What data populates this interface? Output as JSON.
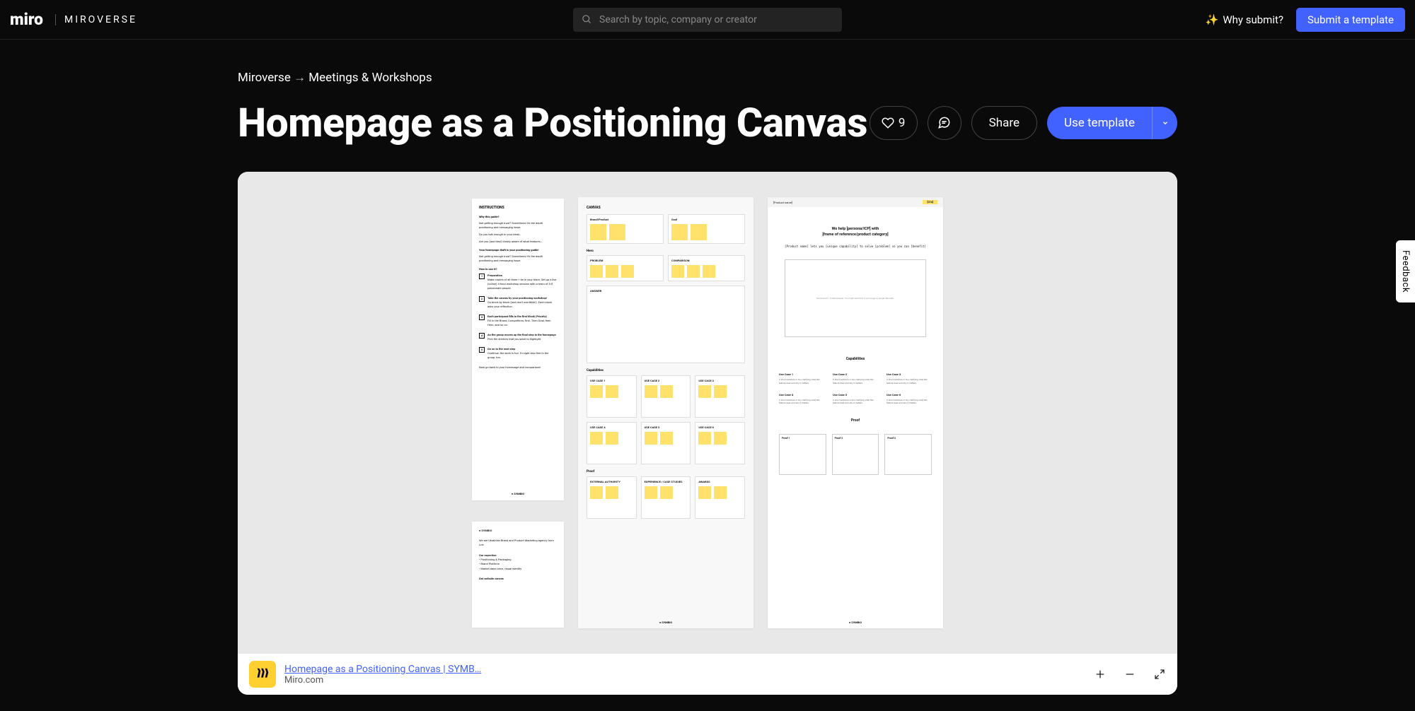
{
  "brand": {
    "name": "miro",
    "sub": "MIROVERSE"
  },
  "search": {
    "placeholder": "Search by topic, company or creator"
  },
  "header": {
    "why_submit": "Why submit?",
    "why_submit_emoji": "✨",
    "submit": "Submit a template"
  },
  "breadcrumb": {
    "root": "Miroverse",
    "arrow": "→",
    "category": "Meetings & Workshops"
  },
  "page": {
    "title": "Homepage as a Positioning Canvas"
  },
  "actions": {
    "likes": "9",
    "share": "Share",
    "use": "Use template"
  },
  "bottombar": {
    "title": "Homepage as a Positioning Canvas | SYMB…",
    "sub": "Miro.com"
  },
  "feedback": "Feedback",
  "preview": {
    "instructions": {
      "title": "INSTRUCTIONS",
      "why_h": "Why this guide?",
      "why_p1": "Not getting enough trust? Sometimes it's the depth positioning and messaging issue.",
      "why_p2": "Do you talk enough to your ideal…",
      "why_p3": "Are you (and they) clearly aware of what features…",
      "pos_h": "Your homepage draft is your positioning guide!",
      "how_h": "How to use it?",
      "steps": [
        {
          "n": "1",
          "h": "Preparation",
          "p": "Make copies of all three + be in your team. Set up a live (online) 4-hour workshop session with a team of 3-5 passionate people."
        },
        {
          "n": "2",
          "h": "Take the canvas by your positioning workshop!",
          "p": "Go block by block (and don't overthink!). Each block asks your reflection."
        },
        {
          "n": "3",
          "h": "Each participant fills in the first block (Priority)",
          "p": "Fill in the Brand, Competitors, first. Then Goal, then Hero, and so on."
        },
        {
          "n": "4",
          "h": "As the group moves up the final step in the homepage",
          "p": "Pick the stickers that you want to highlight."
        },
        {
          "n": "5",
          "h": "Go on to the next step",
          "p": "Continue, the work is fun. It might also feel in the group, too."
        }
      ],
      "footer": "Now go back to your homepage and comparison!",
      "brand_tag": "● SYMBIO"
    },
    "symbio": {
      "brand": "● SYMBIO",
      "p1": "We are Ukrainian Brand and Product Marketing agency from Lviv.",
      "skills_h": "Our expertise:",
      "skill1": "• Positioning & Packaging",
      "skill2": "• Brand Platform",
      "skill3": "• Market data voice, visual identity",
      "contact": "Get website canvas"
    },
    "canvas": {
      "title": "CANVAS",
      "brand_h": "Brand/Product",
      "goal_h": "Goal",
      "hero_h": "Hero",
      "problem_h": "PROBLEM",
      "comp_h": "COMPARISON",
      "answer_h": "ANSWER",
      "caps_h": "Capabilities",
      "uc1": "USE CASE 1",
      "uc2": "USE CASE 2",
      "uc3": "USE CASE 3",
      "uc4": "USE CASE 4",
      "uc5": "USE CASE 5",
      "uc6": "USE CASE 6",
      "proof_h": "Proof",
      "ext": "EXTERNAL AUTHORITY",
      "exp": "EXPERIENCE / CASE STUDIES",
      "award": "AWARDS",
      "brand_tag": "● SYMBIO"
    },
    "homepage": {
      "product_name": "[Product name]",
      "cta": "[CTA]",
      "hero1": "We help [persona/ICP] with",
      "hero2": "[frame of reference/product category]",
      "sub": "[Product name] lets you [unique capability] to solve [problem] so you can [benefit]",
      "placeholder_text": "Social proof / trusted people. You might want this in your page so people feel safe.",
      "caps_h": "Capabilities",
      "uc": [
        "Use Case 1",
        "Use Case 2",
        "Use Case 3",
        "Use Case 4",
        "Use Case 5",
        "Use Case 6"
      ],
      "uc_p": "A short sentence or two clarifying what this feature does and why it matters.",
      "proof_h": "Proof",
      "proof": [
        "Proof 1",
        "Proof 2",
        "Proof 3"
      ],
      "brand_tag": "● SYMBIO"
    }
  }
}
